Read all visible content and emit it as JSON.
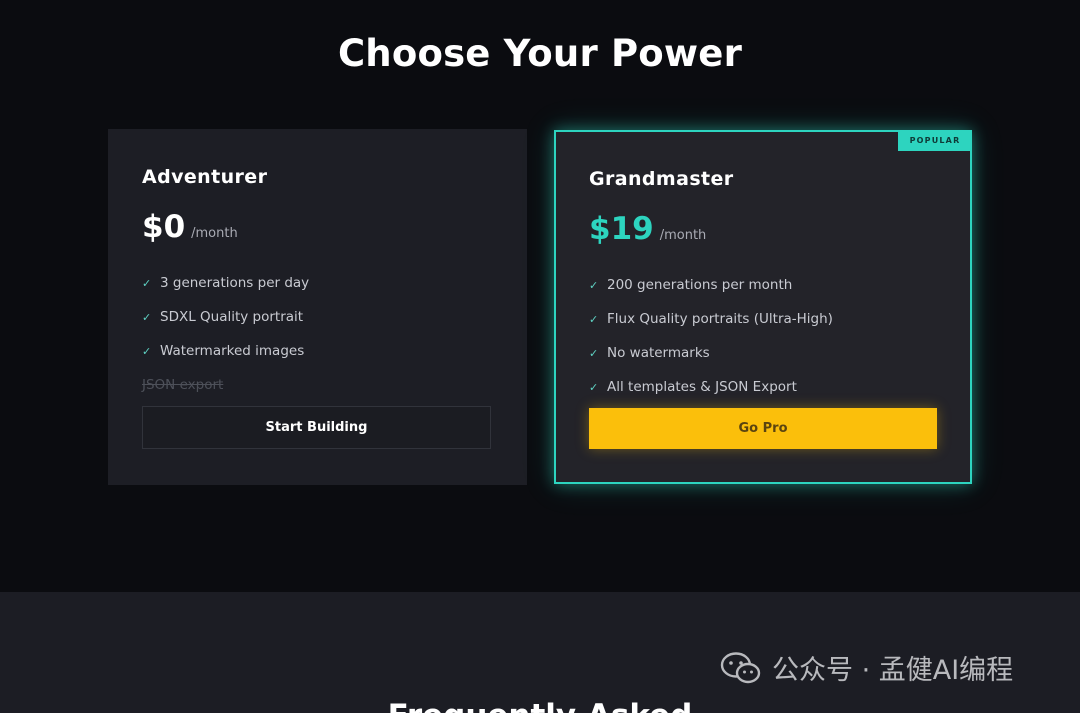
{
  "page_title": "Choose Your Power",
  "plans": [
    {
      "name": "Adventurer",
      "price": "$0",
      "period": "/month",
      "features": [
        {
          "label": "3 generations per day",
          "included": true
        },
        {
          "label": "SDXL Quality portrait",
          "included": true
        },
        {
          "label": "Watermarked images",
          "included": true
        },
        {
          "label": "JSON export",
          "included": false
        }
      ],
      "cta": "Start Building"
    },
    {
      "name": "Grandmaster",
      "badge": "POPULAR",
      "price": "$19",
      "period": "/month",
      "features": [
        {
          "label": "200 generations per month",
          "included": true
        },
        {
          "label": "Flux Quality portraits (Ultra-High)",
          "included": true
        },
        {
          "label": "No watermarks",
          "included": true
        },
        {
          "label": "All templates & JSON Export",
          "included": true
        }
      ],
      "cta": "Go Pro"
    }
  ],
  "check_glyph": "✓",
  "faq_title": "Frequently Asked",
  "watermark_text": "公众号 · 孟健AI编程",
  "colors": {
    "accent": "#2dd4bf",
    "cta_pro": "#fbbf0b",
    "background": "#0b0c10"
  }
}
